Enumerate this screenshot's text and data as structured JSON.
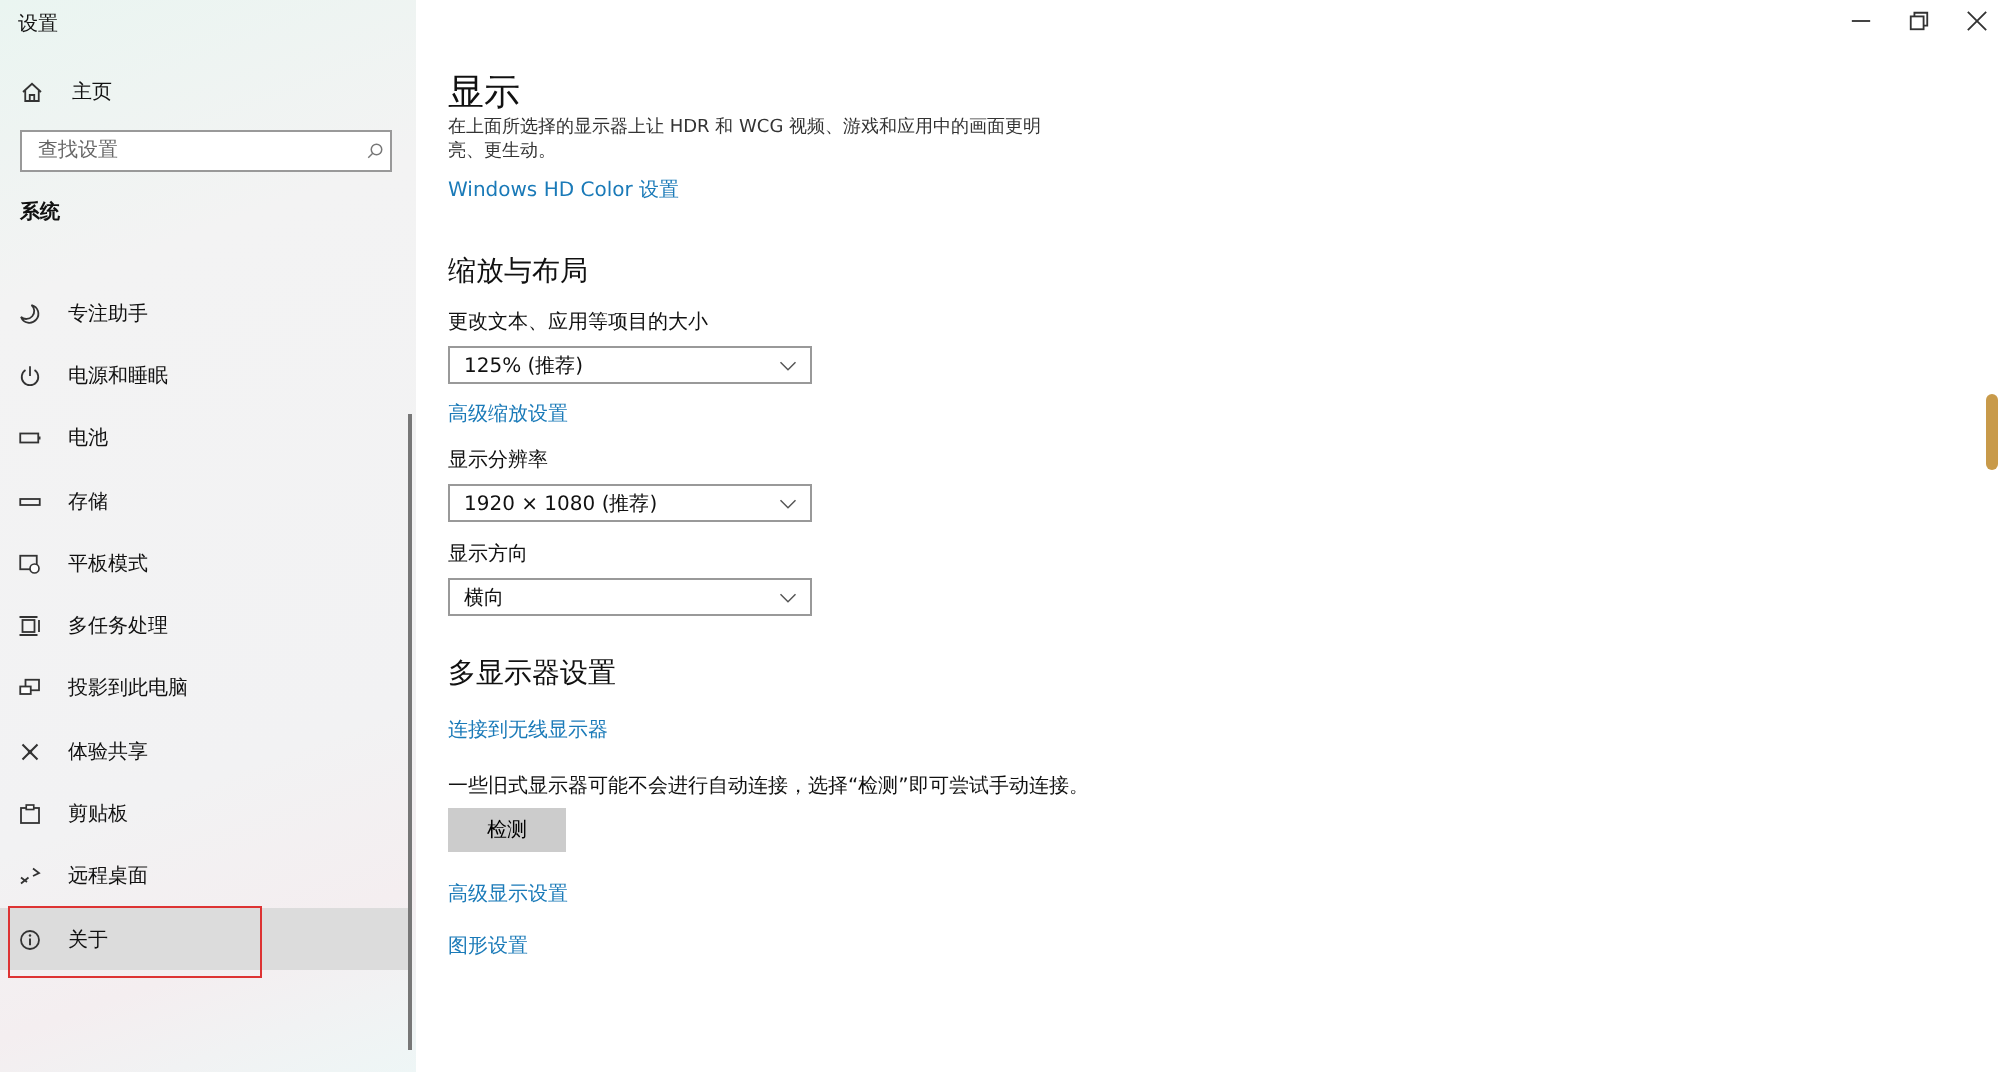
{
  "window": {
    "title": "设置"
  },
  "sidebar": {
    "home": "主页",
    "search": {
      "placeholder": "查找设置"
    },
    "section": "系统",
    "items": [
      {
        "label": "专注助手",
        "selected": false
      },
      {
        "label": "电源和睡眠",
        "selected": false
      },
      {
        "label": "电池",
        "selected": false
      },
      {
        "label": "存储",
        "selected": false
      },
      {
        "label": "平板模式",
        "selected": false
      },
      {
        "label": "多任务处理",
        "selected": false
      },
      {
        "label": "投影到此电脑",
        "selected": false
      },
      {
        "label": "体验共享",
        "selected": false
      },
      {
        "label": "剪贴板",
        "selected": false
      },
      {
        "label": "远程桌面",
        "selected": false
      },
      {
        "label": "关于",
        "selected": true
      }
    ]
  },
  "main": {
    "title": "显示",
    "description": "在上面所选择的显示器上让 HDR 和 WCG 视频、游戏和应用中的画面更明亮、更生动。",
    "hdr_link": "Windows HD Color 设置",
    "scale_section": {
      "heading": "缩放与布局",
      "fields": [
        {
          "label": "更改文本、应用等项目的大小",
          "value": "125% (推荐)",
          "link": "高级缩放设置"
        },
        {
          "label": "显示分辨率",
          "value": "1920 × 1080 (推荐)"
        },
        {
          "label": "显示方向",
          "value": "横向"
        }
      ]
    },
    "multi_section": {
      "heading": "多显示器设置",
      "wireless_link": "连接到无线显示器",
      "note": "一些旧式显示器可能不会进行自动连接，选择“检测”即可尝试手动连接。",
      "detect_button": "检测",
      "links": [
        "高级显示设置",
        "图形设置"
      ]
    }
  }
}
